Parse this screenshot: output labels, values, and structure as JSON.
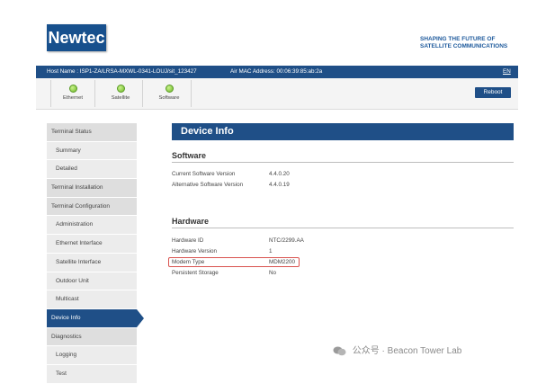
{
  "brand": {
    "logo": "Newtec",
    "tagline_line1": "SHAPING THE FUTURE OF",
    "tagline_line2": "SATELLITE COMMUNICATIONS"
  },
  "hostbar": {
    "host": "Host Name : ISP1-ZA/LRSA-MXWL-0341-LOUJ/sit_123427",
    "mac": "Air MAC Address:  00:06:39:85:ab:2a",
    "lang": "EN"
  },
  "nav": {
    "items": [
      {
        "label": "Ethernet"
      },
      {
        "label": "Satellite"
      },
      {
        "label": "Software"
      }
    ],
    "reboot": "Reboot"
  },
  "sidebar": {
    "items": [
      {
        "label": "Terminal Status"
      },
      {
        "label": "Summary"
      },
      {
        "label": "Detailed"
      },
      {
        "label": "Terminal Installation"
      },
      {
        "label": "Terminal Configuration"
      },
      {
        "label": "Administration"
      },
      {
        "label": "Ethernet Interface"
      },
      {
        "label": "Satellite Interface"
      },
      {
        "label": "Outdoor Unit"
      },
      {
        "label": "Multicast"
      },
      {
        "label": "Device Info"
      },
      {
        "label": "Diagnostics"
      },
      {
        "label": "Logging"
      },
      {
        "label": "Test"
      }
    ]
  },
  "main": {
    "title": "Device Info",
    "software": {
      "heading": "Software",
      "rows": [
        {
          "label": "Current Software Version",
          "value": "4.4.0.20"
        },
        {
          "label": "Alternative Software Version",
          "value": "4.4.0.19"
        }
      ]
    },
    "hardware": {
      "heading": "Hardware",
      "rows": [
        {
          "label": "Hardware ID",
          "value": "NTC/2299.AA"
        },
        {
          "label": "Hardware Version",
          "value": "1"
        },
        {
          "label": "Modem Type",
          "value": "MDM2200"
        },
        {
          "label": "Persistent Storage",
          "value": "No"
        }
      ]
    }
  },
  "watermark": {
    "text": "公众号 · Beacon Tower Lab"
  },
  "colors": {
    "primary": "#1f4f87",
    "highlight": "#d9534f",
    "status_green": "#6fb92a"
  }
}
